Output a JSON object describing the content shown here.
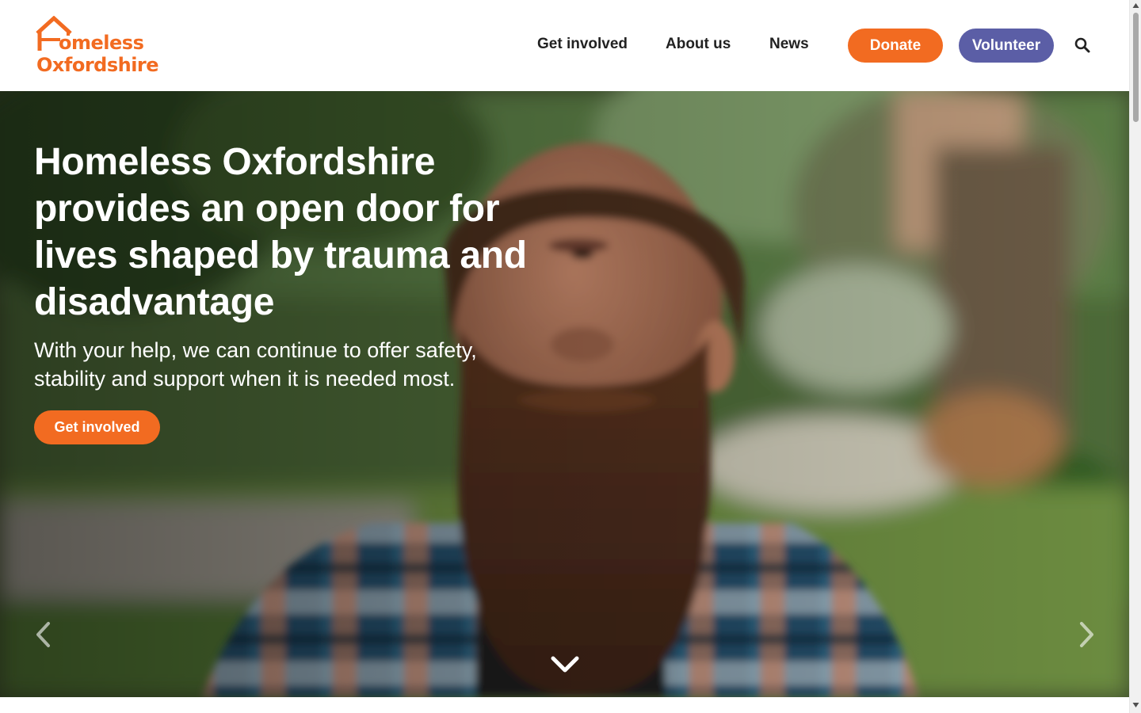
{
  "header": {
    "logo": {
      "line1": "omeless",
      "line2": "Oxfordshire",
      "icon": "house-icon",
      "color": "#f26b21"
    },
    "nav": [
      {
        "label": "Get involved"
      },
      {
        "label": "About us"
      },
      {
        "label": "News"
      }
    ],
    "buttons": {
      "donate": "Donate",
      "volunteer": "Volunteer"
    },
    "search_icon": "search-icon"
  },
  "hero": {
    "title": "Homeless Oxfordshire provides an open door for lives shaped by trauma and disadvantage",
    "subtitle": "With your help, we can continue to offer safety, stability and support when it is needed most.",
    "cta_label": "Get involved",
    "image": "bearded-man-in-plaid-shirt-photo",
    "prev_icon": "chevron-left-icon",
    "next_icon": "chevron-right-icon",
    "scroll_icon": "chevron-down-icon"
  },
  "colors": {
    "accent_orange": "#f26b21",
    "accent_purple": "#5b5ea6",
    "nav_text": "#222222"
  }
}
